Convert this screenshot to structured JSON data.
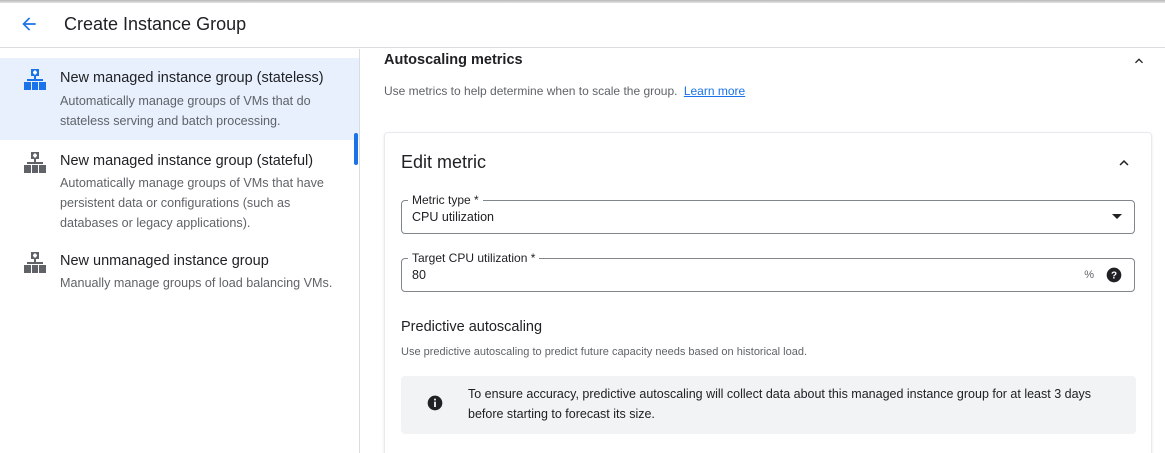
{
  "header": {
    "title": "Create Instance Group",
    "back_icon": "arrow-back-icon"
  },
  "sidebar": {
    "items": [
      {
        "title": "New managed instance group (stateless)",
        "description": "Automatically manage groups of VMs that do stateless serving and batch processing.",
        "icon": "managed-group-icon",
        "selected": true
      },
      {
        "title": "New managed instance group (stateful)",
        "description": "Automatically manage groups of VMs that have persistent data or configurations (such as databases or legacy applications).",
        "icon": "managed-group-icon",
        "selected": false
      },
      {
        "title": "New unmanaged instance group",
        "description": "Manually manage groups of load balancing VMs.",
        "icon": "unmanaged-group-icon",
        "selected": false
      }
    ]
  },
  "autoscaling": {
    "title": "Autoscaling metrics",
    "description": "Use metrics to help determine when to scale the group.",
    "learn_more": "Learn more"
  },
  "edit_metric": {
    "title": "Edit metric",
    "metric_type": {
      "label": "Metric type *",
      "value": "CPU utilization"
    },
    "target": {
      "label": "Target CPU utilization *",
      "value": "80",
      "unit": "%"
    }
  },
  "predictive": {
    "title": "Predictive autoscaling",
    "description": "Use predictive autoscaling to predict future capacity needs based on historical load.",
    "info": "To ensure accuracy, predictive autoscaling will collect data about this managed instance group for at least 3 days before starting to forecast its size."
  },
  "colors": {
    "accent": "#1a73e8",
    "selected_bg": "#e8f0fe",
    "icon_gray": "#5f6368"
  }
}
